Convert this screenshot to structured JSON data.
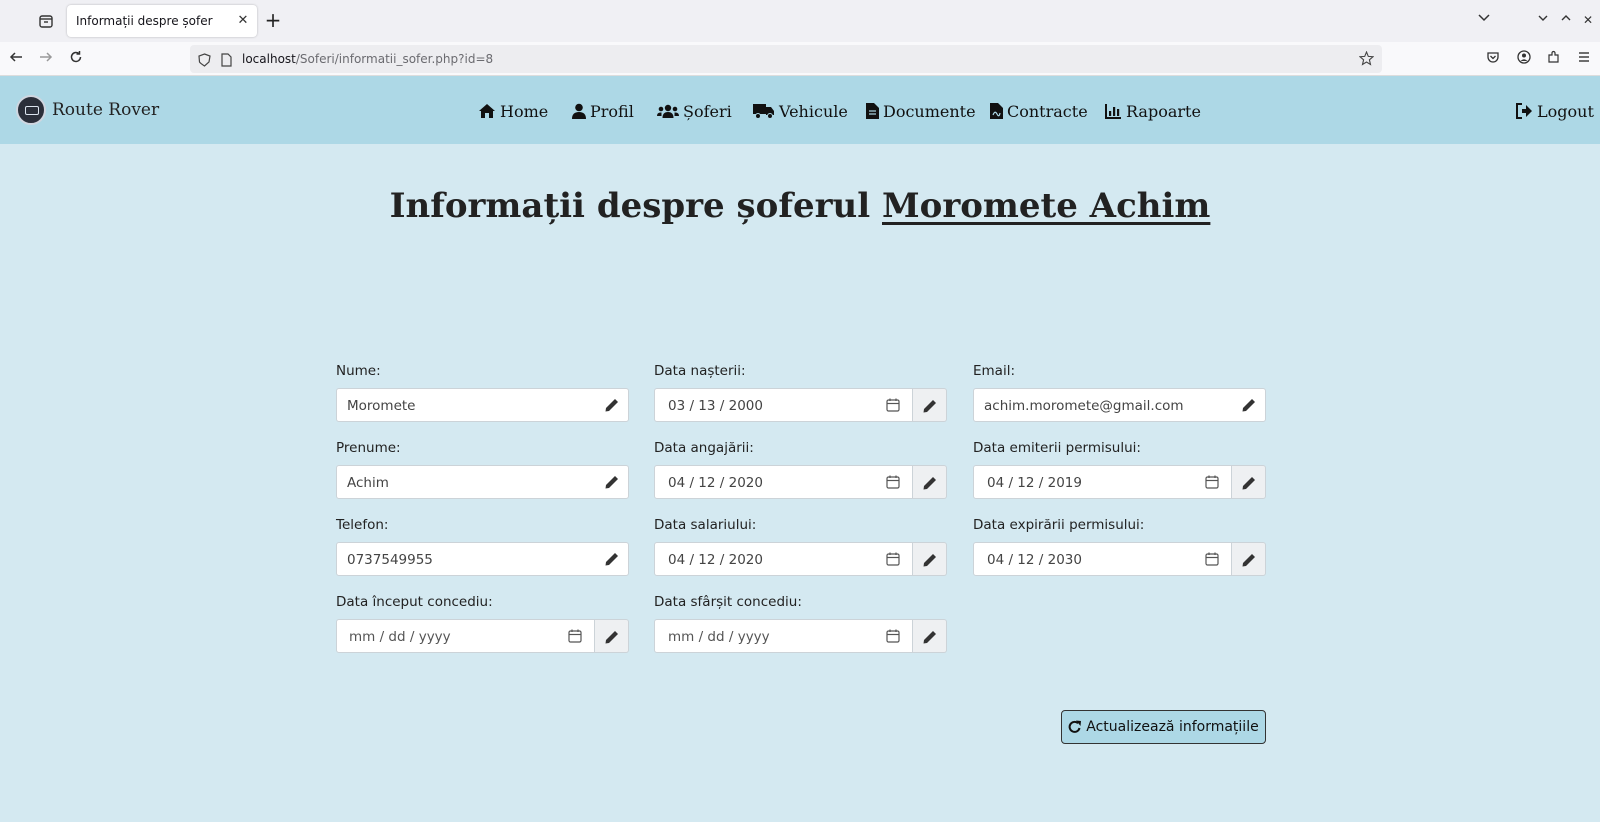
{
  "browser": {
    "tab_title": "Informații despre șofer",
    "url_host": "localhost",
    "url_path": "/Soferi/informatii_sofer.php?id=8"
  },
  "site": {
    "brand": "Route Rover",
    "menu": [
      {
        "label": "Home",
        "icon": "home-icon"
      },
      {
        "label": "Profil",
        "icon": "user-icon"
      },
      {
        "label": "Șoferi",
        "icon": "users-icon"
      },
      {
        "label": "Vehicule",
        "icon": "truck-icon"
      },
      {
        "label": "Documente",
        "icon": "file-icon"
      },
      {
        "label": "Contracte",
        "icon": "contract-icon"
      },
      {
        "label": "Rapoarte",
        "icon": "chart-icon"
      }
    ],
    "logout": "Logout"
  },
  "page": {
    "title_prefix": "Informații despre șoferul",
    "driver_name": "Moromete Achim"
  },
  "form": {
    "nume": {
      "label": "Nume:",
      "value": "Moromete"
    },
    "prenume": {
      "label": "Prenume:",
      "value": "Achim"
    },
    "telefon": {
      "label": "Telefon:",
      "value": "0737549955"
    },
    "data_nasterii": {
      "label": "Data nașterii:",
      "value": "03 / 13 / 2000"
    },
    "data_angajarii": {
      "label": "Data angajării:",
      "value": "04 / 12 / 2020"
    },
    "data_salariului": {
      "label": "Data salariului:",
      "value": "04 / 12 / 2020"
    },
    "email": {
      "label": "Email:",
      "value": "achim.moromete@gmail.com"
    },
    "data_emiterii_permisului": {
      "label": "Data emiterii permisului:",
      "value": "04 / 12 / 2019"
    },
    "data_expirarii_permisului": {
      "label": "Data expirării permisului:",
      "value": "04 / 12 / 2030"
    },
    "data_inceput_concediu": {
      "label": "Data început concediu:",
      "placeholder": "mm / dd / yyyy"
    },
    "data_sfarsit_concediu": {
      "label": "Data sfârșit concediu:",
      "placeholder": "mm / dd / yyyy"
    }
  },
  "update_button": "Actualizează informațiile"
}
